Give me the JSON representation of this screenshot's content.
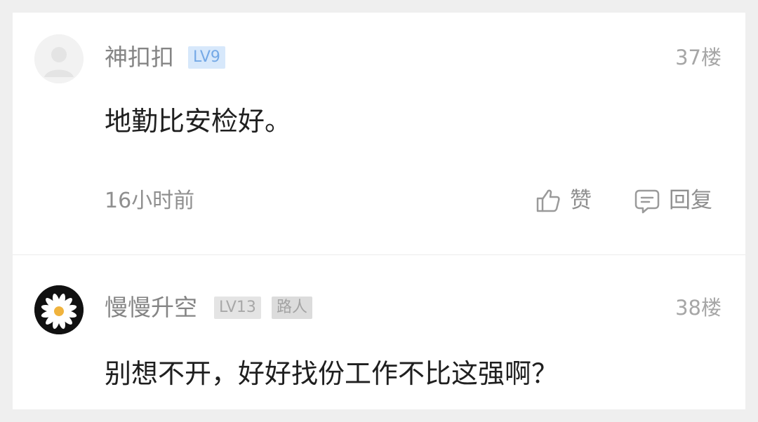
{
  "comments": [
    {
      "username": "神扣扣",
      "level": "LV9",
      "floor": "37楼",
      "content": "地勤比安检好。",
      "time": "16小时前",
      "actions": {
        "like_label": "赞",
        "reply_label": "回复"
      },
      "avatar_icon": "default-user-avatar"
    },
    {
      "username": "慢慢升空",
      "level": "LV13",
      "role": "路人",
      "floor": "38楼",
      "content": "别想不开，好好找份工作不比这强啊？",
      "avatar_icon": "daisy-avatar"
    }
  ],
  "colors": {
    "page_background": "#efefef",
    "card_background": "#ffffff",
    "username": "#858585",
    "content": "#1f1f1f",
    "meta": "#a6a6a6",
    "level_badge_blue": "#d7e8fb",
    "level_text_blue": "#75a9e6",
    "level_badge_gray": "#e4e4e4"
  }
}
